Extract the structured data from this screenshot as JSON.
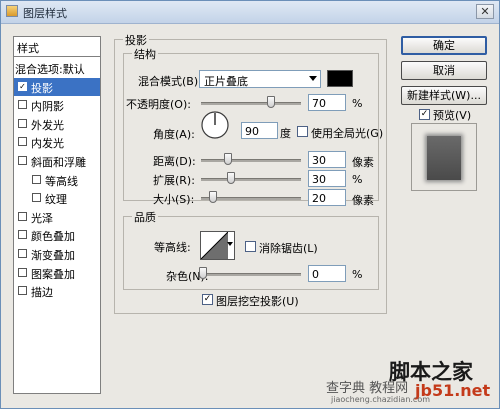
{
  "window": {
    "title": "图层样式"
  },
  "stylelist": {
    "header": "样式",
    "items": [
      {
        "label": "混合选项:默认",
        "checkbox": false,
        "checked": false,
        "indent": 0
      },
      {
        "label": "投影",
        "checkbox": true,
        "checked": true,
        "indent": 0,
        "selected": true
      },
      {
        "label": "内阴影",
        "checkbox": true,
        "checked": false,
        "indent": 0
      },
      {
        "label": "外发光",
        "checkbox": true,
        "checked": false,
        "indent": 0
      },
      {
        "label": "内发光",
        "checkbox": true,
        "checked": false,
        "indent": 0
      },
      {
        "label": "斜面和浮雕",
        "checkbox": true,
        "checked": false,
        "indent": 0
      },
      {
        "label": "等高线",
        "checkbox": true,
        "checked": false,
        "indent": 1
      },
      {
        "label": "纹理",
        "checkbox": true,
        "checked": false,
        "indent": 1
      },
      {
        "label": "光泽",
        "checkbox": true,
        "checked": false,
        "indent": 0
      },
      {
        "label": "颜色叠加",
        "checkbox": true,
        "checked": false,
        "indent": 0
      },
      {
        "label": "渐变叠加",
        "checkbox": true,
        "checked": false,
        "indent": 0
      },
      {
        "label": "图案叠加",
        "checkbox": true,
        "checked": false,
        "indent": 0
      },
      {
        "label": "描边",
        "checkbox": true,
        "checked": false,
        "indent": 0
      }
    ]
  },
  "dropshadow": {
    "title": "投影",
    "structure": {
      "title": "结构",
      "blend_mode_label": "混合模式(B):",
      "blend_mode_value": "正片叠底",
      "shadow_color": "#000000",
      "opacity_label": "不透明度(O):",
      "opacity_value": "70",
      "opacity_unit": "%",
      "opacity_fraction": 0.7,
      "angle_label": "角度(A):",
      "angle_value": "90",
      "angle_unit": "度",
      "global_light_label": "使用全局光(G)",
      "global_light_checked": false,
      "distance_label": "距离(D):",
      "distance_value": "30",
      "distance_unit": "像素",
      "spread_label": "扩展(R):",
      "spread_value": "30",
      "spread_unit": "%",
      "size_label": "大小(S):",
      "size_value": "20",
      "size_unit": "像素"
    },
    "quality": {
      "title": "品质",
      "contour_label": "等高线:",
      "antialias_label": "消除锯齿(L)",
      "antialias_checked": false,
      "noise_label": "杂色(N):",
      "noise_value": "0",
      "noise_unit": "%"
    },
    "knockout_label": "图层挖空投影(U)",
    "knockout_checked": true
  },
  "buttons": {
    "ok": "确定",
    "cancel": "取消",
    "new_style": "新建样式(W)...",
    "preview_label": "预览(V)",
    "preview_checked": true
  },
  "watermark": {
    "brand": "脚本之家",
    "site": "jb51.net",
    "sub": "查字典 教程网",
    "sub_url": "jiaocheng.chazidian.com"
  }
}
